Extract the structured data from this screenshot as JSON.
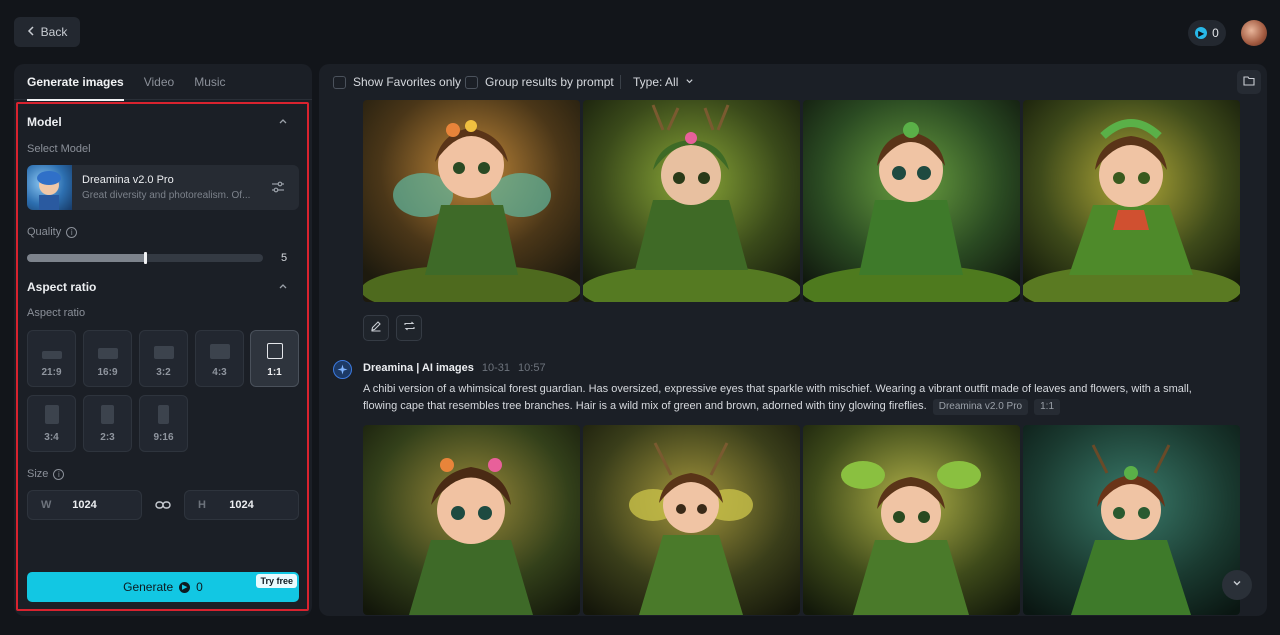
{
  "topbar": {
    "back_label": "Back",
    "credits": "0"
  },
  "left": {
    "tabs": [
      {
        "label": "Generate images"
      },
      {
        "label": "Video"
      },
      {
        "label": "Music"
      }
    ],
    "model_section": {
      "title": "Model",
      "select_label": "Select Model",
      "model_name": "Dreamina v2.0 Pro",
      "model_desc": "Great diversity and photorealism. Of..."
    },
    "quality": {
      "label": "Quality",
      "value": "5",
      "fraction": 0.5
    },
    "aspect_section": {
      "title": "Aspect ratio",
      "sub_label": "Aspect ratio",
      "options": [
        {
          "label": "21:9"
        },
        {
          "label": "16:9"
        },
        {
          "label": "3:2"
        },
        {
          "label": "4:3"
        },
        {
          "label": "1:1"
        },
        {
          "label": "3:4"
        },
        {
          "label": "2:3"
        },
        {
          "label": "9:16"
        }
      ],
      "selected": "1:1"
    },
    "size": {
      "label": "Size",
      "w_prefix": "W",
      "w_value": "1024",
      "h_prefix": "H",
      "h_value": "1024"
    },
    "generate": {
      "label": "Generate",
      "cost": "0",
      "badge": "Try free"
    }
  },
  "right": {
    "filters": {
      "favorites": "Show Favorites only",
      "group": "Group results by prompt",
      "type": "Type: All"
    },
    "generation": {
      "author": "Dreamina | AI images",
      "date": "10-31",
      "time": "10:57",
      "prompt": "A chibi version of a whimsical forest guardian. Has oversized, expressive eyes that sparkle with mischief. Wearing a vibrant outfit made of leaves and flowers, with a small, flowing cape that resembles tree branches. Hair is a wild mix of green and brown, adorned with tiny glowing fireflies.",
      "model_tag": "Dreamina v2.0 Pro",
      "ratio_tag": "1:1"
    }
  },
  "colors": {
    "accent": "#12c7e3",
    "highlight": "#d9232f"
  }
}
